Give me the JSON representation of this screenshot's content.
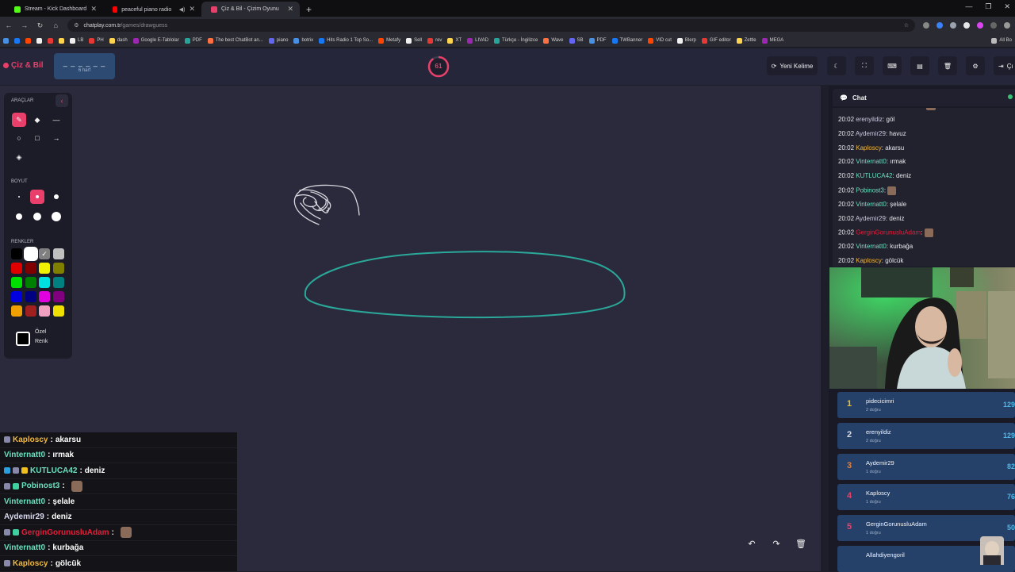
{
  "browser": {
    "tabs": [
      {
        "title": "Stream - Kick Dashboard",
        "color": "#53fc18",
        "active": false
      },
      {
        "title": "peaceful piano radio 🎹 m",
        "color": "#ff0000",
        "active": false
      },
      {
        "title": "Çiz & Bil - Çizim Oyunu",
        "color": "#e8406a",
        "active": true
      }
    ],
    "url_host": "chatplay.com.tr",
    "url_path": "/games/drawguess",
    "bookmarks": [
      "LB",
      "PH",
      "dash",
      "Google E-Tablolar",
      "PDF",
      "The best ChatBot an...",
      "piano",
      "botrix",
      "Hits Radio 1 Top So...",
      "Metafy",
      "Sell",
      "rev",
      "XT",
      "LIVAD",
      "Türkçe - İngilizce",
      "Wave",
      "SB",
      "PDF",
      "TWBanner",
      "VID cut",
      "Blerp",
      "GIF editor",
      "Zettle",
      "MEGA"
    ],
    "all_bookmarks": "All Bo"
  },
  "app": {
    "logo": "Çiz & Bil",
    "word_blanks": "_ _ _ _ _ _",
    "word_length": "6 harf",
    "timer": "61",
    "timer_fraction": 0.9,
    "new_word_label": "Yeni Kelime",
    "right_cut_label": "Çı"
  },
  "toolbox": {
    "tools_title": "ARAÇLAR",
    "size_title": "BOYUT",
    "colors_title": "RENKLER",
    "custom_color_line1": "Özel",
    "custom_color_line2": "Renk",
    "colors": [
      "#000000",
      "#ffffff",
      "#808080",
      "#c0c0c0",
      "#e00000",
      "#800000",
      "#f0f000",
      "#808000",
      "#00e000",
      "#008000",
      "#00e0e0",
      "#008080",
      "#0000e0",
      "#000080",
      "#e000e0",
      "#800080",
      "#f0a000",
      "#a02020",
      "#f0a0c0",
      "#f0e000"
    ]
  },
  "overlay_chat": [
    {
      "user": "Kaploscy",
      "color": "#f0b840",
      "msg": "akarsu",
      "badges": [
        "#8888aa"
      ]
    },
    {
      "user": "Vinternatt0",
      "color": "#6ae0c0",
      "msg": "ırmak",
      "badges": []
    },
    {
      "user": "KUTLUCA42",
      "color": "#6ae0c0",
      "msg": "deniz",
      "badges": [
        "#2aa0e0",
        "#8888aa",
        "#f0c020"
      ]
    },
    {
      "user": "Pobinost3",
      "color": "#6ae0c0",
      "msg": "",
      "badges": [
        "#8888aa",
        "#40d0a0"
      ],
      "emote": true
    },
    {
      "user": "Vinternatt0",
      "color": "#6ae0c0",
      "msg": "şelale",
      "badges": []
    },
    {
      "user": "Aydemir29",
      "color": "#d8d8f0",
      "msg": "deniz",
      "badges": []
    },
    {
      "user": "GerginGorunusluAdam",
      "color": "#e0203a",
      "msg": "",
      "badges": [
        "#8888aa",
        "#40d0a0"
      ],
      "emote": true
    },
    {
      "user": "Vinternatt0",
      "color": "#6ae0c0",
      "msg": "kurbağa",
      "badges": []
    },
    {
      "user": "Kaploscy",
      "color": "#f0b840",
      "msg": "gölcük",
      "badges": [
        "#8888aa"
      ]
    }
  ],
  "chat": {
    "title": "Chat",
    "messages": [
      {
        "time": "20:02",
        "user": "erenyildiz",
        "color": "#c8c8e0",
        "msg": "göl"
      },
      {
        "time": "20:02",
        "user": "Aydemir29",
        "color": "#c8c8e0",
        "msg": "havuz"
      },
      {
        "time": "20:02",
        "user": "Kaploscy",
        "color": "#f0b840",
        "msg": "akarsu"
      },
      {
        "time": "20:02",
        "user": "Vinternatt0",
        "color": "#6ae0c0",
        "msg": "ırmak"
      },
      {
        "time": "20:02",
        "user": "KUTLUCA42",
        "color": "#6ae0c0",
        "msg": "deniz"
      },
      {
        "time": "20:02",
        "user": "Pobinost3",
        "color": "#6ae0c0",
        "msg": "",
        "emote": true
      },
      {
        "time": "20:02",
        "user": "Vinternatt0",
        "color": "#6ae0c0",
        "msg": "şelale"
      },
      {
        "time": "20:02",
        "user": "Aydemir29",
        "color": "#c8c8e0",
        "msg": "deniz"
      },
      {
        "time": "20:02",
        "user": "GerginGorunusluAdam",
        "color": "#e0203a",
        "msg": "",
        "emote": true
      },
      {
        "time": "20:02",
        "user": "Vinternatt0",
        "color": "#6ae0c0",
        "msg": "kurbağa"
      },
      {
        "time": "20:02",
        "user": "Kaploscy",
        "color": "#f0b840",
        "msg": "gölcük"
      }
    ]
  },
  "leaderboard": [
    {
      "rank": "1",
      "name": "pidecicimri",
      "sub": "2 doğru",
      "score": "129",
      "rank_color": "#f0c020"
    },
    {
      "rank": "2",
      "name": "erenyildiz",
      "sub": "2 doğru",
      "score": "129",
      "rank_color": "#d8d8e0"
    },
    {
      "rank": "3",
      "name": "Aydemir29",
      "sub": "1 doğru",
      "score": "82",
      "rank_color": "#e08040"
    },
    {
      "rank": "4",
      "name": "Kaploscy",
      "sub": "1 doğru",
      "score": "76",
      "rank_color": "#e8406a"
    },
    {
      "rank": "5",
      "name": "GerginGorunusluAdam",
      "sub": "1 doğru",
      "score": "50",
      "rank_color": "#e8406a"
    },
    {
      "rank": "",
      "name": "Allahdiyengoril",
      "sub": "",
      "score": "",
      "rank_color": "#e8406a"
    }
  ]
}
